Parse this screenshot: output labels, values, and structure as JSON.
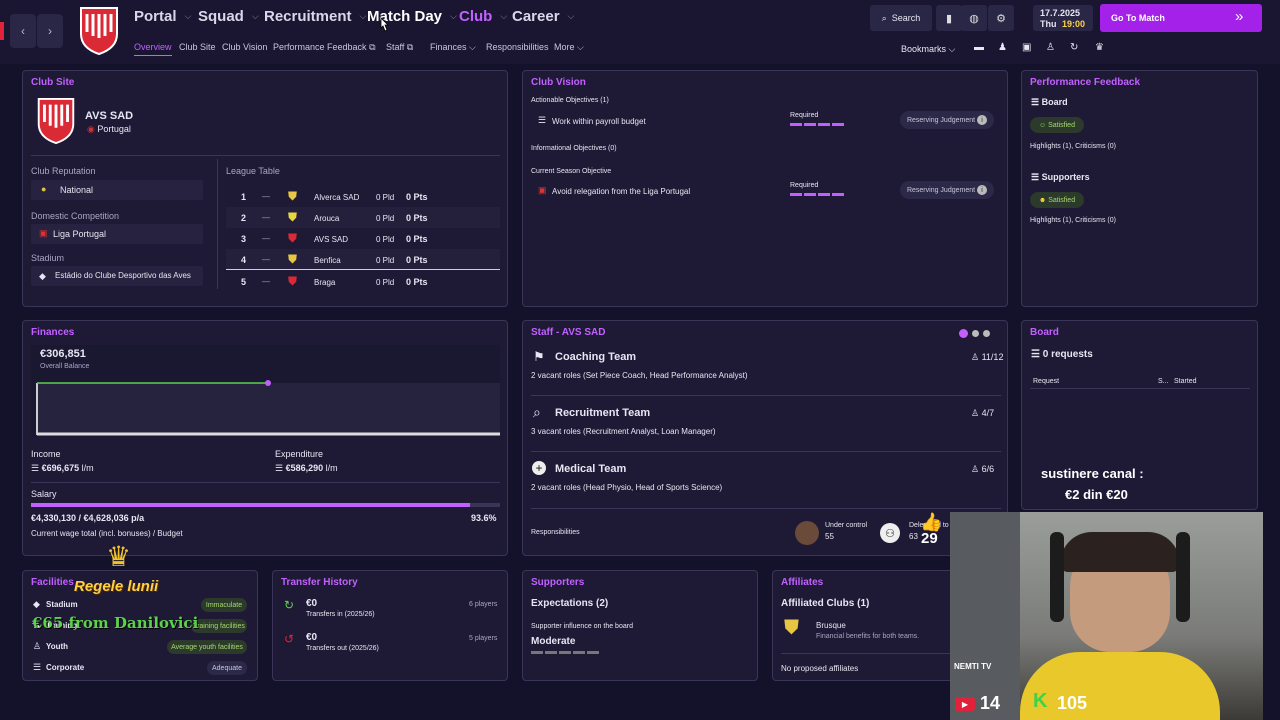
{
  "topbar": {
    "menus": [
      "Portal",
      "Squad",
      "Recruitment",
      "Match Day",
      "Club",
      "Career"
    ],
    "subnav": [
      "Overview",
      "Club Site",
      "Club Vision",
      "Performance Feedback",
      "Staff",
      "Finances",
      "Responsibilities",
      "More"
    ],
    "search_label": "Search",
    "date": "17.7.2025",
    "day": "Thu",
    "time": "19:00",
    "go_to_match": "Go To Match",
    "bookmarks": "Bookmarks"
  },
  "club_site": {
    "title": "Club Site",
    "club_name": "AVS SAD",
    "country": "Portugal",
    "reputation_label": "Club Reputation",
    "reputation": "National",
    "domestic_label": "Domestic Competition",
    "domestic": "Liga Portugal",
    "stadium_label": "Stadium",
    "stadium": "Estádio do Clube Desportivo das Aves",
    "league_label": "League Table",
    "league": [
      {
        "pos": "1",
        "dash": "—",
        "team": "Alverca SAD",
        "pld": "0 Pld",
        "pts": "0 Pts"
      },
      {
        "pos": "2",
        "dash": "—",
        "team": "Arouca",
        "pld": "0 Pld",
        "pts": "0 Pts"
      },
      {
        "pos": "3",
        "dash": "—",
        "team": "AVS SAD",
        "pld": "0 Pld",
        "pts": "0 Pts"
      },
      {
        "pos": "4",
        "dash": "—",
        "team": "Benfica",
        "pld": "0 Pld",
        "pts": "0 Pts"
      },
      {
        "pos": "5",
        "dash": "—",
        "team": "Braga",
        "pld": "0 Pld",
        "pts": "0 Pts"
      }
    ]
  },
  "club_vision": {
    "title": "Club Vision",
    "actionable": "Actionable Objectives",
    "actionable_count": "(1)",
    "obj1": "Work within payroll budget",
    "required": "Required",
    "reserving": "Reserving Judgement",
    "informational": "Informational Objectives",
    "informational_count": "(0)",
    "current": "Current Season Objective",
    "obj2": "Avoid relegation from the Liga Portugal"
  },
  "perf": {
    "title": "Performance Feedback",
    "board": "Board",
    "satisfied": "Satisfied",
    "highlights": "Highlights (1),",
    "criticisms": "Criticisms (0)",
    "supporters": "Supporters"
  },
  "finances": {
    "title": "Finances",
    "balance": "€306,851",
    "balance_label": "Overall Balance",
    "income_label": "Income",
    "income": "€696,675",
    "income_unit": "l/m",
    "expenditure_label": "Expenditure",
    "expenditure": "€586,290",
    "expenditure_unit": "l/m",
    "salary_label": "Salary",
    "salary": "€4,330,130 / €4,628,036 p/a",
    "salary_pct": "93.6%",
    "salary_fraction": 0.936,
    "salary_note": "Current wage total (incl. bonuses) / Budget"
  },
  "staff": {
    "title": "Staff - AVS SAD",
    "teams": [
      {
        "name": "Coaching Team",
        "count": "11/12",
        "vacant": "2 vacant roles (Set Piece Coach, Head Performance Analyst)"
      },
      {
        "name": "Recruitment Team",
        "count": "4/7",
        "vacant": "3 vacant roles (Recruitment Analyst, Loan Manager)"
      },
      {
        "name": "Medical Team",
        "count": "6/6",
        "vacant": "2 vacant roles (Head Physio, Head of Sports Science)"
      }
    ],
    "responsibilities": "Responsibilities",
    "under_control": "Under control",
    "under_control_n": "55",
    "delegated": "Delegated to",
    "delegated_n": "63"
  },
  "board": {
    "title": "Board",
    "requests": "0 requests",
    "col_request": "Request",
    "col_s": "S...",
    "col_started": "Started"
  },
  "facilities": {
    "title": "Facilities",
    "rows": [
      {
        "name": "Stadium",
        "status": "Immaculate"
      },
      {
        "name": "Training",
        "status": "Training facilities"
      },
      {
        "name": "Youth",
        "status": "Average youth facilities"
      },
      {
        "name": "Corporate",
        "status": "Adequate"
      }
    ]
  },
  "transfers": {
    "title": "Transfer History",
    "in_amount": "€0",
    "in_label": "Transfers in (2025/26)",
    "in_players": "6 players",
    "out_amount": "€0",
    "out_label": "Transfers out (2025/26)",
    "out_players": "5 players"
  },
  "supporters": {
    "title": "Supporters",
    "expectations": "Expectations (2)",
    "influence": "Supporter influence on the board",
    "level": "Moderate"
  },
  "affiliates": {
    "title": "Affiliates",
    "heading": "Affiliated Clubs (1)",
    "club": "Brusque",
    "desc": "Financial benefits for both teams.",
    "none": "No proposed affiliates"
  },
  "overlay": {
    "donate_line1": "sustinere canal :",
    "donate_line2": "€2 din €20",
    "king_title": "Regele lunii",
    "king_from": "€65 from Danilovici",
    "likes": "29",
    "yt": "14",
    "kick": "105",
    "webcam_text": "NEMTI TV"
  },
  "colors": {
    "accent": "#c260ff",
    "bg": "#14112a",
    "panel": "#1e1a36",
    "green": "#5cd14a"
  }
}
